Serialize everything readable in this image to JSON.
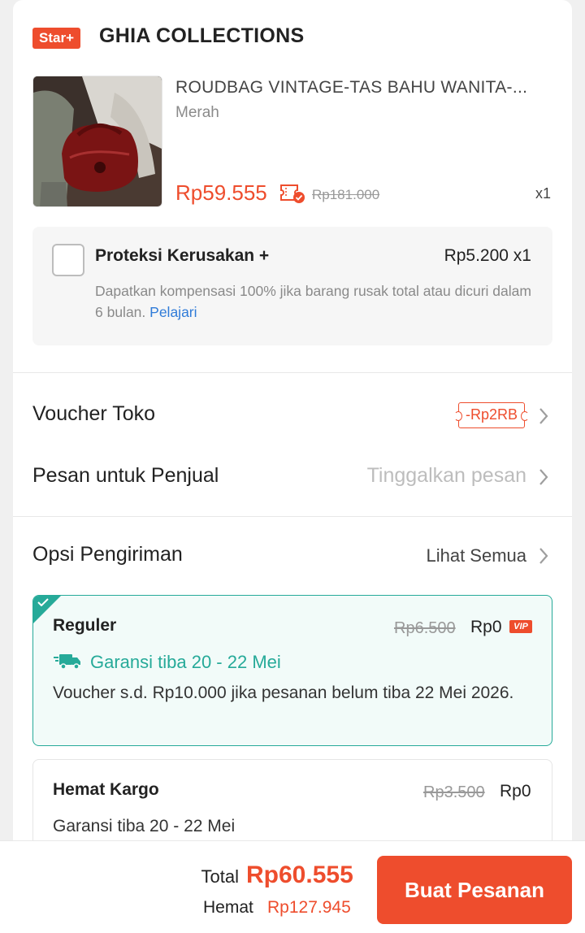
{
  "shop": {
    "badge": "Star+",
    "name": "GHIA COLLECTIONS"
  },
  "product": {
    "name": "ROUDBAG VINTAGE-TAS BAHU WANITA-...",
    "variant": "Merah",
    "price": "Rp59.555",
    "original_price": "Rp181.000",
    "quantity": "x1"
  },
  "protection": {
    "title": "Proteksi Kerusakan +",
    "price": "Rp5.200 x1",
    "description": "Dapatkan kompensasi 100% jika barang rusak total atau dicuri dalam 6 bulan.",
    "link": "Pelajari"
  },
  "voucher": {
    "label": "Voucher Toko",
    "value": "-Rp2RB"
  },
  "message": {
    "label": "Pesan untuk Penjual",
    "placeholder": "Tinggalkan pesan"
  },
  "shipping": {
    "label": "Opsi Pengiriman",
    "see_all": "Lihat Semua",
    "options": [
      {
        "name": "Reguler",
        "original_price": "Rp6.500",
        "price": "Rp0",
        "badge": "VIP",
        "guarantee": "Garansi tiba 20 - 22 Mei",
        "note": "Voucher s.d.  Rp10.000 jika pesanan belum tiba 22 Mei 2026.",
        "selected": true
      },
      {
        "name": "Hemat Kargo",
        "original_price": "Rp3.500",
        "price": "Rp0",
        "guarantee": "Garansi tiba 20 - 22 Mei",
        "selected": false
      }
    ]
  },
  "footer": {
    "total_label": "Total",
    "total_value": "Rp60.555",
    "savings_label": "Hemat",
    "savings_value": "Rp127.945",
    "order_button": "Buat Pesanan"
  },
  "colors": {
    "brand": "#ee4d2d",
    "teal": "#26aa99",
    "link": "#2f7bd8"
  }
}
